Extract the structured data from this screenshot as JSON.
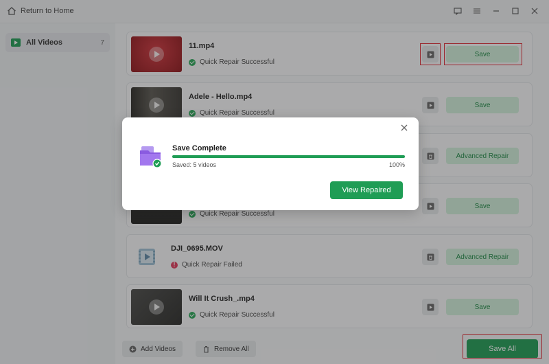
{
  "topbar": {
    "home_label": "Return to Home",
    "home_icon": "home-icon",
    "controls": [
      "feedback-icon",
      "menu-icon",
      "minimize-icon",
      "maximize-icon",
      "close-icon"
    ]
  },
  "sidebar": {
    "items": [
      {
        "label": "All Videos",
        "count": "7",
        "icon": "video-icon"
      }
    ]
  },
  "videos": [
    {
      "name": "11.mp4",
      "status": "Quick Repair Successful",
      "status_type": "success",
      "action": "Save",
      "icon_action": "play-icon"
    },
    {
      "name": "Adele - Hello.mp4",
      "status": "Quick Repair Successful",
      "status_type": "success",
      "action": "Save",
      "icon_action": "play-icon"
    },
    {
      "name": "",
      "status": "",
      "status_type": "",
      "action": "Advanced Repair",
      "icon_action": "delete-icon"
    },
    {
      "name": "",
      "status": "Quick Repair Successful",
      "status_type": "success",
      "action": "Save",
      "icon_action": "play-icon"
    },
    {
      "name": "DJI_0695.MOV",
      "status": "Quick Repair Failed",
      "status_type": "failed",
      "action": "Advanced Repair",
      "icon_action": "delete-icon"
    },
    {
      "name": "Will It Crush_.mp4",
      "status": "Quick Repair Successful",
      "status_type": "success",
      "action": "Save",
      "icon_action": "play-icon"
    }
  ],
  "bottom": {
    "add_label": "Add Videos",
    "remove_label": "Remove All",
    "save_all_label": "Save All"
  },
  "modal": {
    "title": "Save Complete",
    "progress": 1.0,
    "saved_text": "Saved: 5 videos",
    "percent_text": "100%",
    "button_label": "View Repaired"
  },
  "colors": {
    "accent": "#1f9d55",
    "accent_light": "#d2f0dc",
    "highlight": "#e0262f",
    "fail": "#e23b5c"
  }
}
